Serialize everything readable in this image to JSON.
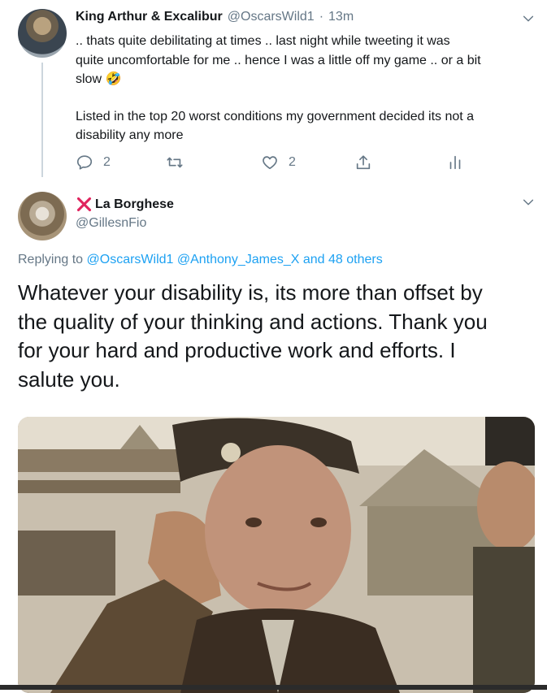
{
  "tweet1": {
    "author_name": "King Arthur & Excalibur",
    "handle": "@OscarsWild1",
    "separator": "·",
    "time": "13m",
    "body_lines": [
      ".. thats quite debilitating at times .. last night while tweeting it was",
      "quite uncomfortable for me .. hence I was a little off my game .. or a bit",
      "slow"
    ],
    "emoji": "🤣",
    "body_paragraph2_lines": [
      "Listed in the top 20 worst conditions my government decided its not a",
      "disability any more"
    ],
    "reply_count": "2",
    "retweet_count": "",
    "like_count": "2"
  },
  "tweet2": {
    "name_prefix_icon": "red-x",
    "author_name": "La Borghese",
    "handle": "@GillesnFio",
    "replying_prefix": "Replying to",
    "replying_to": "@OscarsWild1 @Anthony_James_X and 48 others",
    "text": "Whatever your disability is, its more than offset by the quality of your thinking and actions. Thank you for your hard and productive work and efforts. I salute you.",
    "text_lines": [
      "Whatever your disability is, its more than offset by",
      "the quality of your thinking and actions. Thank you",
      "for your hard and productive work and efforts. I",
      "salute you."
    ]
  },
  "colors": {
    "link": "#1da1f2",
    "secondary_text": "#657786",
    "primary_text": "#14171a",
    "x_icon": "#e0245e"
  },
  "icons": {
    "reply": "reply-icon",
    "retweet": "retweet-icon",
    "like": "like-icon",
    "share": "share-icon",
    "analytics": "analytics-icon",
    "menu": "chevron-down-icon"
  }
}
